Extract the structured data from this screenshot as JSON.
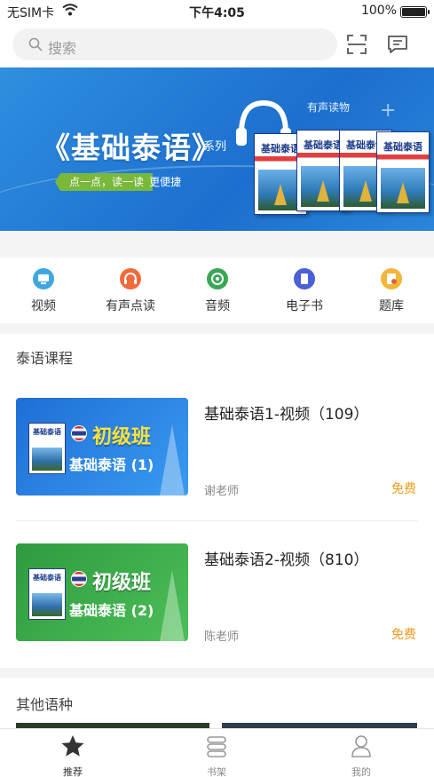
{
  "status_bar": {
    "carrier": "无SIM卡",
    "time": "下午4:05",
    "battery": "100%"
  },
  "header": {
    "search_placeholder": "搜索",
    "icons": [
      "search-icon",
      "scan-icon",
      "message-icon"
    ]
  },
  "banner": {
    "title": "《基础泰语》",
    "series_label": "系列",
    "slogan": "点一点，读一读",
    "slogan_suffix": "更便捷",
    "audio_tag": "有声读物",
    "book_title": "基础泰语",
    "books": [
      "1",
      "2",
      "3",
      "4"
    ]
  },
  "categories": [
    {
      "label": "视频",
      "icon": "video-icon",
      "color": "#3fa7e0"
    },
    {
      "label": "有声点读",
      "icon": "audio-reader-icon",
      "color": "#f06a3a"
    },
    {
      "label": "音频",
      "icon": "audio-icon",
      "color": "#3aa657"
    },
    {
      "label": "电子书",
      "icon": "ebook-icon",
      "color": "#4a5fd8"
    },
    {
      "label": "题库",
      "icon": "question-bank-icon",
      "color": "#f2b63a"
    }
  ],
  "courses_section": {
    "title": "泰语课程",
    "courses": [
      {
        "name": "基础泰语1-视频（109）",
        "teacher": "谢老师",
        "price": "免费",
        "thumb_level": "初级班",
        "thumb_name": "基础泰语 (1)",
        "thumb_color": "#2b7fe0"
      },
      {
        "name": "基础泰语2-视频（810）",
        "teacher": "陈老师",
        "price": "免费",
        "thumb_level": "初级班",
        "thumb_name": "基础泰语 (2)",
        "thumb_color": "#3aa84a"
      }
    ]
  },
  "other_section": {
    "title": "其他语种"
  },
  "tabbar": [
    {
      "label": "推荐",
      "icon": "star-icon",
      "active": true
    },
    {
      "label": "书架",
      "icon": "bookshelf-icon",
      "active": false
    },
    {
      "label": "我的",
      "icon": "profile-icon",
      "active": false
    }
  ]
}
